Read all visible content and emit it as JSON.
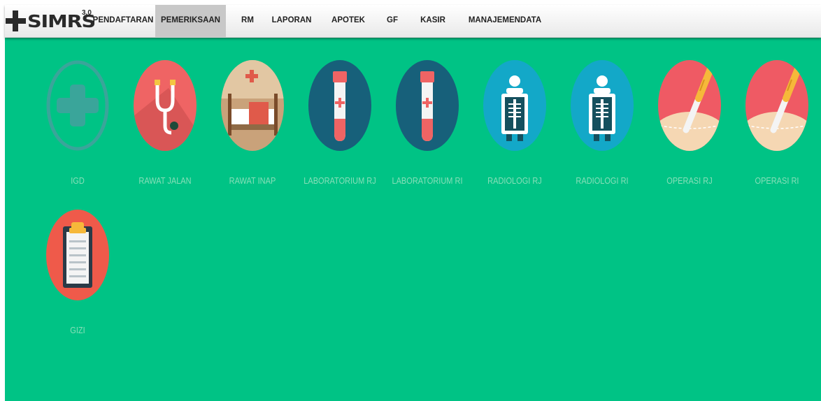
{
  "app": {
    "brand": "SIMRS",
    "version": "3.0"
  },
  "menu": [
    {
      "label": "PENDAFTARAN"
    },
    {
      "label": "PEMERIKSAAN",
      "active": true
    },
    {
      "label": "RM"
    },
    {
      "label": "LAPORAN"
    },
    {
      "label": "APOTEK"
    },
    {
      "label": "GF"
    },
    {
      "label": "KASIR"
    },
    {
      "label": "MANAJEMENDATA"
    }
  ],
  "modules": [
    {
      "label": "IGD",
      "icon": "medical-cross-icon"
    },
    {
      "label": "RAWAT JALAN",
      "icon": "stethoscope-icon"
    },
    {
      "label": "RAWAT INAP",
      "icon": "hospital-bed-icon"
    },
    {
      "label": "LABORATORIUM RJ",
      "icon": "test-tube-icon"
    },
    {
      "label": "LABORATORIUM RI",
      "icon": "test-tube-icon"
    },
    {
      "label": "RADIOLOGI RJ",
      "icon": "xray-icon"
    },
    {
      "label": "RADIOLOGI RI",
      "icon": "xray-icon"
    },
    {
      "label": "OPERASI RJ",
      "icon": "scalpel-icon"
    },
    {
      "label": "OPERASI RI",
      "icon": "scalpel-icon"
    },
    {
      "label": "GIZI",
      "icon": "clipboard-icon"
    }
  ],
  "colors": {
    "background": "#00c385",
    "label": "#88dfb9",
    "navbar": "#ececec",
    "active_tab": "#c8c8c8"
  }
}
